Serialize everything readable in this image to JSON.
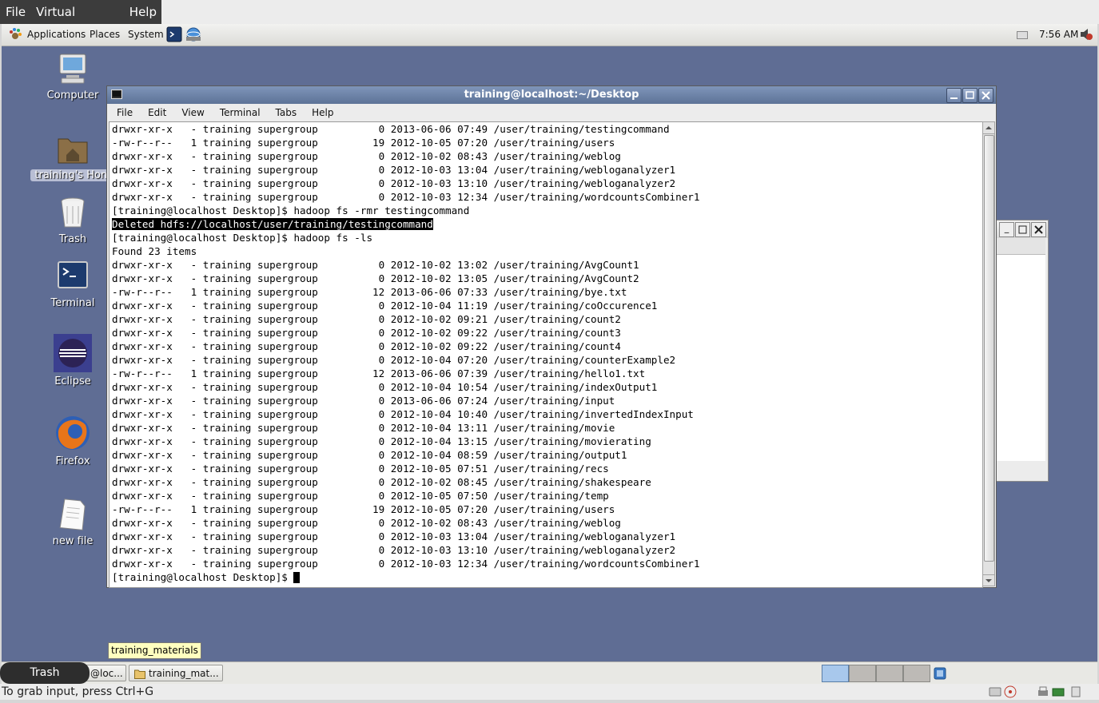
{
  "vm_menu": [
    "File",
    "Virtual Machine",
    "Help"
  ],
  "panel": {
    "menus": [
      "Applications",
      "Places",
      "System"
    ],
    "clock": "7:56 AM"
  },
  "desktop_icons": [
    {
      "label": "Computer",
      "icon": "computer-icon"
    },
    {
      "label": "training's Hom",
      "icon": "home-folder-icon"
    },
    {
      "label": "Trash",
      "icon": "trash-icon"
    },
    {
      "label": "Terminal",
      "icon": "terminal-icon"
    },
    {
      "label": "Eclipse",
      "icon": "eclipse-icon"
    },
    {
      "label": "Firefox",
      "icon": "firefox-icon"
    },
    {
      "label": "new file",
      "icon": "file-icon"
    }
  ],
  "terminal": {
    "title": "training@localhost:~/Desktop",
    "menu": [
      "File",
      "Edit",
      "View",
      "Terminal",
      "Tabs",
      "Help"
    ],
    "lines": [
      "drwxr-xr-x   - training supergroup          0 2013-06-06 07:49 /user/training/testingcommand",
      "-rw-r--r--   1 training supergroup         19 2012-10-05 07:20 /user/training/users",
      "drwxr-xr-x   - training supergroup          0 2012-10-02 08:43 /user/training/weblog",
      "drwxr-xr-x   - training supergroup          0 2012-10-03 13:04 /user/training/webloganalyzer1",
      "drwxr-xr-x   - training supergroup          0 2012-10-03 13:10 /user/training/webloganalyzer2",
      "drwxr-xr-x   - training supergroup          0 2012-10-03 12:34 /user/training/wordcountsCombiner1",
      "[training@localhost Desktop]$ hadoop fs -rmr testingcommand",
      "Deleted hdfs://localhost/user/training/testingcommand",
      "[training@localhost Desktop]$ hadoop fs -ls",
      "Found 23 items",
      "drwxr-xr-x   - training supergroup          0 2012-10-02 13:02 /user/training/AvgCount1",
      "drwxr-xr-x   - training supergroup          0 2012-10-02 13:05 /user/training/AvgCount2",
      "-rw-r--r--   1 training supergroup         12 2013-06-06 07:33 /user/training/bye.txt",
      "drwxr-xr-x   - training supergroup          0 2012-10-04 11:19 /user/training/coOccurence1",
      "drwxr-xr-x   - training supergroup          0 2012-10-02 09:21 /user/training/count2",
      "drwxr-xr-x   - training supergroup          0 2012-10-02 09:22 /user/training/count3",
      "drwxr-xr-x   - training supergroup          0 2012-10-02 09:22 /user/training/count4",
      "drwxr-xr-x   - training supergroup          0 2012-10-04 07:20 /user/training/counterExample2",
      "-rw-r--r--   1 training supergroup         12 2013-06-06 07:39 /user/training/hello1.txt",
      "drwxr-xr-x   - training supergroup          0 2012-10-04 10:54 /user/training/indexOutput1",
      "drwxr-xr-x   - training supergroup          0 2013-06-06 07:24 /user/training/input",
      "drwxr-xr-x   - training supergroup          0 2012-10-04 10:40 /user/training/invertedIndexInput",
      "drwxr-xr-x   - training supergroup          0 2012-10-04 13:11 /user/training/movie",
      "drwxr-xr-x   - training supergroup          0 2012-10-04 13:15 /user/training/movierating",
      "drwxr-xr-x   - training supergroup          0 2012-10-04 08:59 /user/training/output1",
      "drwxr-xr-x   - training supergroup          0 2012-10-05 07:51 /user/training/recs",
      "drwxr-xr-x   - training supergroup          0 2012-10-02 08:45 /user/training/shakespeare",
      "drwxr-xr-x   - training supergroup          0 2012-10-05 07:50 /user/training/temp",
      "-rw-r--r--   1 training supergroup         19 2012-10-05 07:20 /user/training/users",
      "drwxr-xr-x   - training supergroup          0 2012-10-02 08:43 /user/training/weblog",
      "drwxr-xr-x   - training supergroup          0 2012-10-03 13:04 /user/training/webloganalyzer1",
      "drwxr-xr-x   - training supergroup          0 2012-10-03 13:10 /user/training/webloganalyzer2",
      "drwxr-xr-x   - training supergroup          0 2012-10-03 12:34 /user/training/wordcountsCombiner1",
      "[training@localhost Desktop]$ "
    ],
    "highlighted_line": 7
  },
  "taskbar": {
    "trash_label": "Trash",
    "task1_label": "@loc...",
    "task2_label": "training_mat...",
    "tooltip": "training_materials"
  },
  "statusbar": {
    "text": "To grab input, press Ctrl+G"
  },
  "colors": {
    "desktop_bg": "#5f6d94",
    "title_bar": "#6c82a8",
    "vm_menu_bg": "#3c3c3c"
  }
}
